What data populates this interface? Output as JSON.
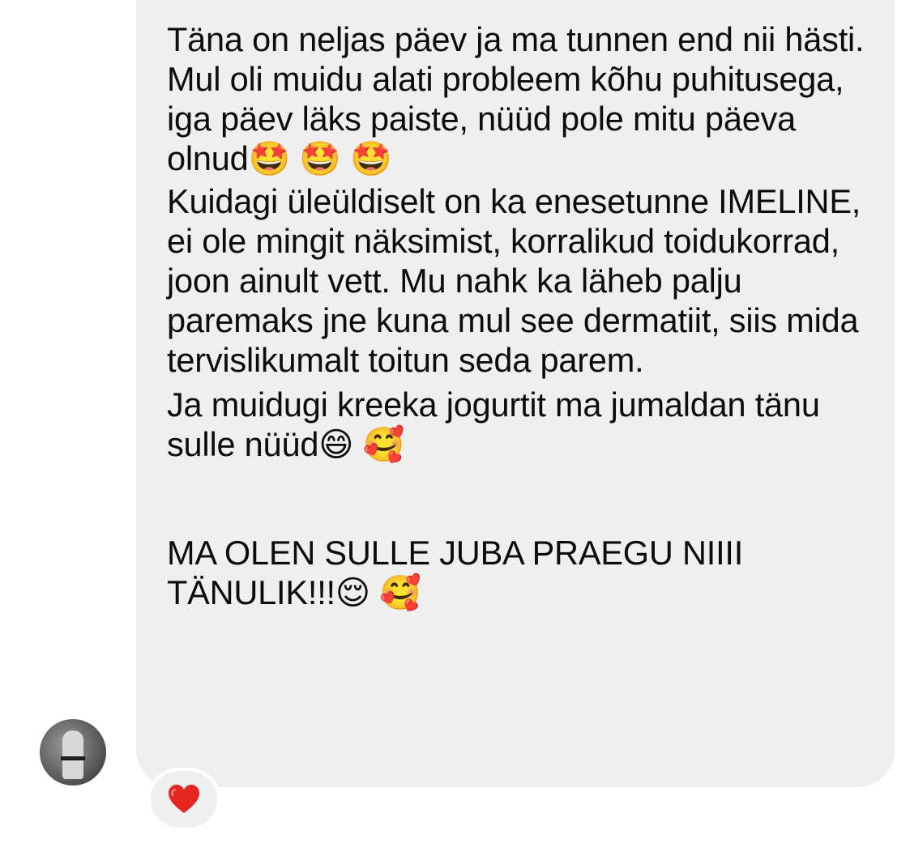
{
  "message": {
    "paragraph_1": "Täna on neljas päev ja ma tunnen end nii hästi. Mul oli muidu alati probleem kõhu puhitusega, iga päev läks paiste, nüüd pole mitu päeva olnud🤩 🤩 🤩",
    "paragraph_2": "Kuidagi üleüldiselt on ka enesetunne IMELINE, ei ole mingit näksimist, korralikud toidukorrad, joon ainult vett. Mu nahk ka läheb palju paremaks jne kuna mul see dermatiit, siis mida tervislikumalt toitun seda parem.",
    "paragraph_3": "Ja muidugi kreeka jogurtit ma jumaldan tänu sulle nüüd😄 🥰",
    "paragraph_4": "MA OLEN SULLE JUBA PRAEGU NIIII TÄNULIK!!!😌 🥰"
  },
  "reaction": {
    "icon": "red-heart-icon",
    "color": "#e5251f"
  },
  "avatar": {
    "icon": "user-avatar"
  }
}
